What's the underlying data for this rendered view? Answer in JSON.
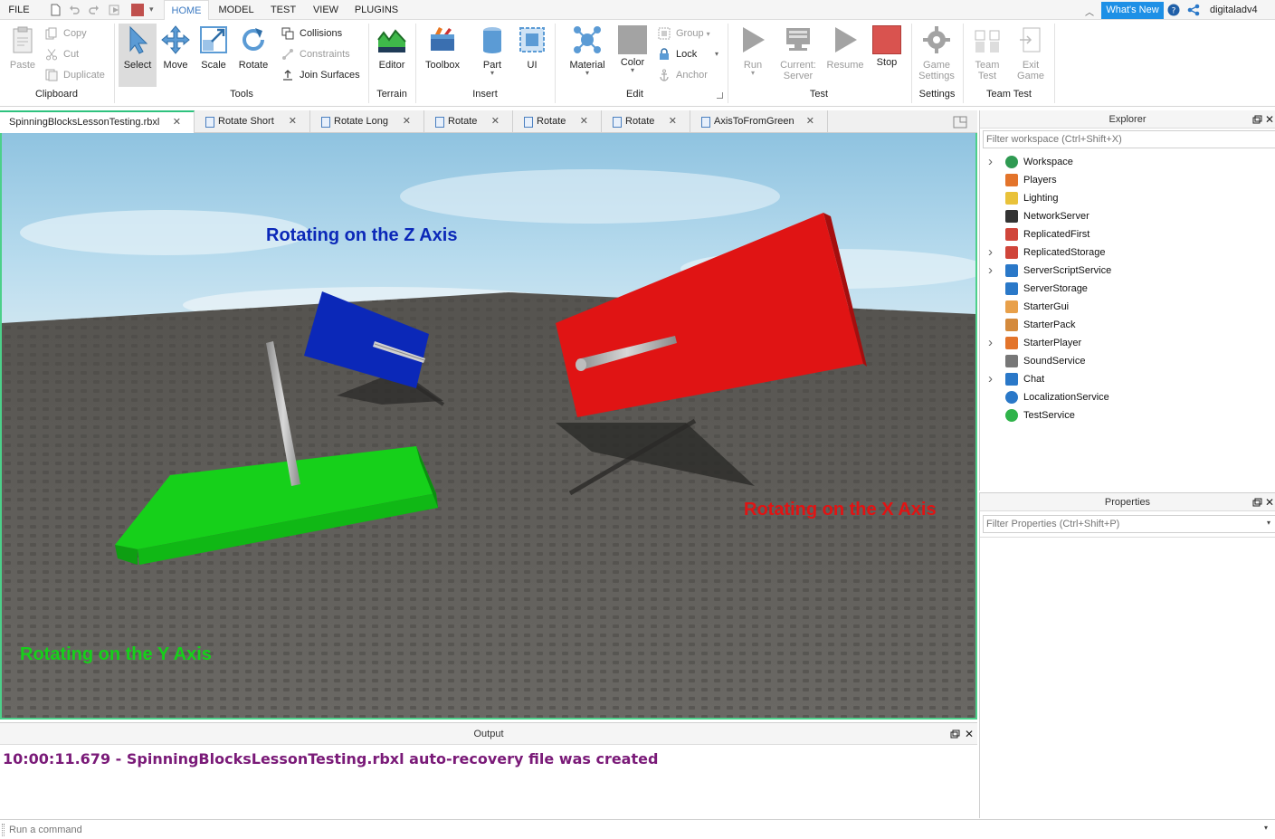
{
  "menubar": {
    "file": "FILE",
    "tabs": [
      "HOME",
      "MODEL",
      "TEST",
      "VIEW",
      "PLUGINS"
    ],
    "whats_new": "What's New",
    "user": "digitaladv4"
  },
  "ribbon": {
    "clipboard": {
      "paste": "Paste",
      "copy": "Copy",
      "cut": "Cut",
      "duplicate": "Duplicate",
      "label": "Clipboard"
    },
    "tools": {
      "select": "Select",
      "move": "Move",
      "scale": "Scale",
      "rotate": "Rotate",
      "collisions": "Collisions",
      "constraints": "Constraints",
      "join_surfaces": "Join Surfaces",
      "label": "Tools"
    },
    "terrain": {
      "editor": "Editor",
      "label": "Terrain"
    },
    "insert": {
      "toolbox": "Toolbox",
      "part": "Part",
      "ui": "UI",
      "label": "Insert"
    },
    "edit": {
      "material": "Material",
      "color": "Color",
      "group": "Group",
      "lock": "Lock",
      "anchor": "Anchor",
      "label": "Edit"
    },
    "test": {
      "run": "Run",
      "current_l1": "Current:",
      "current_l2": "Server",
      "resume": "Resume",
      "stop": "Stop",
      "label": "Test"
    },
    "settings": {
      "game_l1": "Game",
      "game_l2": "Settings",
      "label": "Settings"
    },
    "team_test": {
      "team_l1": "Team",
      "team_l2": "Test",
      "exit_l1": "Exit",
      "exit_l2": "Game",
      "label": "Team Test"
    }
  },
  "doc_tabs": [
    "SpinningBlocksLessonTesting.rbxl",
    "Rotate Short",
    "Rotate Long",
    "Rotate",
    "Rotate",
    "Rotate",
    "AxisToFromGreen"
  ],
  "viewport": {
    "label_z": "Rotating on the Z Axis",
    "label_x": "Rotating on the X Axis",
    "label_y": "Rotating on the Y Axis",
    "colors": {
      "z": "#0b28b8",
      "x": "#e01414",
      "y": "#16d01a"
    }
  },
  "output": {
    "title": "Output",
    "line": "10:00:11.679 - SpinningBlocksLessonTesting.rbxl auto-recovery file was created"
  },
  "command": {
    "placeholder": "Run a command"
  },
  "explorer": {
    "title": "Explorer",
    "filter_placeholder": "Filter workspace (Ctrl+Shift+X)",
    "items": [
      {
        "label": "Workspace",
        "icon": "workspace-icon",
        "expandable": true
      },
      {
        "label": "Players",
        "icon": "players-icon",
        "expandable": false
      },
      {
        "label": "Lighting",
        "icon": "lighting-icon",
        "expandable": false
      },
      {
        "label": "NetworkServer",
        "icon": "network-server-icon",
        "expandable": false
      },
      {
        "label": "ReplicatedFirst",
        "icon": "replicated-first-icon",
        "expandable": false
      },
      {
        "label": "ReplicatedStorage",
        "icon": "replicated-storage-icon",
        "expandable": true
      },
      {
        "label": "ServerScriptService",
        "icon": "server-script-service-icon",
        "expandable": true
      },
      {
        "label": "ServerStorage",
        "icon": "server-storage-icon",
        "expandable": false
      },
      {
        "label": "StarterGui",
        "icon": "starter-gui-icon",
        "expandable": false
      },
      {
        "label": "StarterPack",
        "icon": "starter-pack-icon",
        "expandable": false
      },
      {
        "label": "StarterPlayer",
        "icon": "starter-player-icon",
        "expandable": true
      },
      {
        "label": "SoundService",
        "icon": "sound-service-icon",
        "expandable": false
      },
      {
        "label": "Chat",
        "icon": "chat-icon",
        "expandable": true
      },
      {
        "label": "LocalizationService",
        "icon": "localization-service-icon",
        "expandable": false
      },
      {
        "label": "TestService",
        "icon": "test-service-icon",
        "expandable": false
      }
    ]
  },
  "properties": {
    "title": "Properties",
    "filter_placeholder": "Filter Properties (Ctrl+Shift+P)"
  }
}
